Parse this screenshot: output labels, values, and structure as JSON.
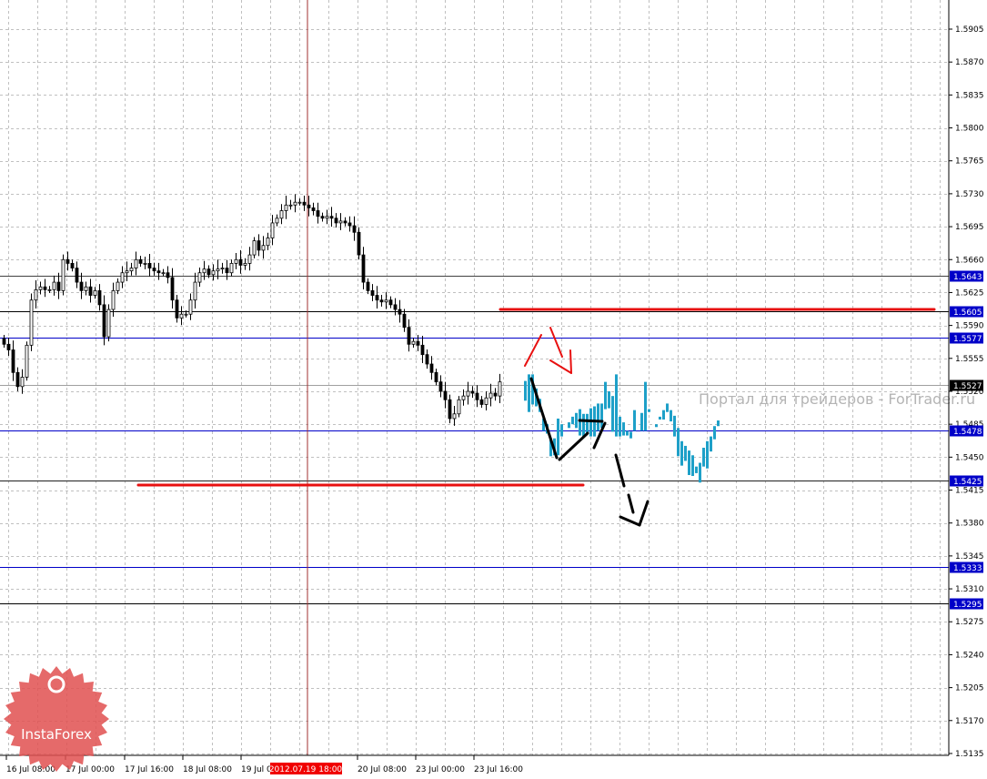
{
  "chart": {
    "symbol_watermark": "Портал для трейдеров - ForTrader.ru",
    "logo_text": "InstaForex",
    "colors": {
      "bull_fill": "#ffffff",
      "bear_fill": "#000000",
      "forecast": "#1ea0c8",
      "level_blue": "#0000c8",
      "drawing_red": "#e81010",
      "drawing_black": "#000000",
      "grid": "#c0c0c0"
    },
    "price_axis": {
      "max": 1.5905,
      "step": 0.0035,
      "ticks": [
        "1.5905",
        "1.5870",
        "1.5835",
        "1.5800",
        "1.5765",
        "1.5730",
        "1.5695",
        "1.5660",
        "1.5625",
        "1.5590",
        "1.5555",
        "1.5520",
        "1.5485",
        "1.5450",
        "1.5415",
        "1.5380",
        "1.5345",
        "1.5310",
        "1.5275",
        "1.5240",
        "1.5205",
        "1.5170",
        "1.5135"
      ]
    },
    "levels": [
      {
        "price": "1.5643",
        "line": "#404040",
        "label_bg": "#0000c8"
      },
      {
        "price": "1.5605",
        "line": "#000000",
        "label_bg": "#0000c8"
      },
      {
        "price": "1.5577",
        "line": "#0000c8",
        "label_bg": "#0000c8"
      },
      {
        "price": "1.5527",
        "line": "#a0a0a0",
        "label_bg": "#000000"
      },
      {
        "price": "1.5478",
        "line": "#0000c8",
        "label_bg": "#0000c8"
      },
      {
        "price": "1.5425",
        "line": "#202020",
        "label_bg": "#0000c8"
      },
      {
        "price": "1.5333",
        "line": "#0000c8",
        "label_bg": "#0000c8"
      },
      {
        "price": "1.5295",
        "line": "#000000",
        "label_bg": "#0000c8"
      }
    ],
    "time_axis": {
      "labels": [
        "16 Jul 08:00",
        "17 Jul 00:00",
        "17 Jul 16:00",
        "18 Jul 08:00",
        "19 Jul 0",
        "20 Jul 08:00",
        "23 Jul 00:00",
        "23 Jul 16:00"
      ],
      "crosshair_label": "2012.07.19 18:00"
    },
    "closes": [
      1.557,
      1.5564,
      1.554,
      1.5525,
      1.5535,
      1.5569,
      1.5617,
      1.5628,
      1.5631,
      1.5628,
      1.5628,
      1.5636,
      1.5627,
      1.566,
      1.5656,
      1.5651,
      1.5636,
      1.5627,
      1.5631,
      1.5622,
      1.5627,
      1.5612,
      1.5578,
      1.5607,
      1.5627,
      1.5636,
      1.5646,
      1.5648,
      1.5651,
      1.566,
      1.5656,
      1.5656,
      1.5651,
      1.5648,
      1.5646,
      1.5646,
      1.5641,
      1.5617,
      1.5598,
      1.5602,
      1.5602,
      1.5617,
      1.5636,
      1.5646,
      1.565,
      1.5644,
      1.5648,
      1.565,
      1.5651,
      1.5646,
      1.5656,
      1.566,
      1.5654,
      1.5656,
      1.5665,
      1.568,
      1.567,
      1.5675,
      1.5683,
      1.5699,
      1.5704,
      1.5712,
      1.5718,
      1.5718,
      1.5721,
      1.5721,
      1.5718,
      1.5715,
      1.5712,
      1.5706,
      1.5704,
      1.5706,
      1.5704,
      1.5699,
      1.5701,
      1.5699,
      1.5696,
      1.5689,
      1.5665,
      1.5636,
      1.5627,
      1.5622,
      1.5617,
      1.5615,
      1.5617,
      1.5612,
      1.5607,
      1.5602,
      1.5588,
      1.557,
      1.5573,
      1.5569,
      1.5559,
      1.5549,
      1.554,
      1.553,
      1.552,
      1.5511,
      1.5491,
      1.5496,
      1.5511,
      1.5515,
      1.552,
      1.5518,
      1.5511,
      1.5506,
      1.5513,
      1.5518,
      1.5515,
      1.553
    ],
    "forecast_bars": [
      [
        1.5531,
        1.551
      ],
      [
        1.5538,
        1.5498
      ],
      [
        1.5538,
        1.5506
      ],
      [
        1.5523,
        1.5504
      ],
      [
        1.5512,
        1.5498
      ],
      [
        1.5491,
        1.5478
      ],
      [
        1.5485,
        1.5475
      ],
      [
        1.547,
        1.5451
      ],
      [
        1.547,
        1.5452
      ],
      [
        1.5491,
        1.5452
      ],
      [
        1.5485,
        1.5472
      ],
      null,
      [
        1.5487,
        1.5481
      ],
      [
        1.5493,
        1.5485
      ],
      [
        1.5497,
        1.5481
      ],
      [
        1.5501,
        1.5473
      ],
      [
        1.5496,
        1.5472
      ],
      [
        1.5496,
        1.5475
      ],
      [
        1.5502,
        1.5472
      ],
      [
        1.5504,
        1.5472
      ],
      [
        1.5507,
        1.5478
      ],
      [
        1.5507,
        1.5481
      ],
      [
        1.553,
        1.5501
      ],
      [
        1.552,
        1.5502
      ],
      [
        1.5515,
        1.5477
      ],
      [
        1.5538,
        1.5472
      ],
      [
        1.5493,
        1.5472
      ],
      [
        1.5487,
        1.5473
      ],
      [
        1.5478,
        1.5473
      ],
      [
        1.5477,
        1.547
      ],
      [
        1.55,
        1.5478
      ],
      null,
      [
        1.5497,
        1.5478
      ],
      [
        1.553,
        1.5478
      ],
      [
        1.5501,
        1.5498
      ],
      null,
      [
        1.5485,
        1.5482
      ],
      [
        1.5493,
        1.549
      ],
      [
        1.55,
        1.549
      ],
      [
        1.5507,
        1.5498
      ],
      [
        1.55,
        1.5488
      ],
      [
        1.5494,
        1.5472
      ],
      [
        1.5481,
        1.5451
      ],
      [
        1.5467,
        1.5441
      ],
      [
        1.5462,
        1.5446
      ],
      [
        1.5457,
        1.5431
      ],
      [
        1.5452,
        1.543
      ],
      [
        1.544,
        1.5433
      ],
      [
        1.5444,
        1.5423
      ],
      [
        1.546,
        1.544
      ],
      [
        1.5467,
        1.5438
      ],
      [
        1.5472,
        1.5456
      ],
      [
        1.5483,
        1.5469
      ],
      [
        1.5489,
        1.5483
      ]
    ]
  }
}
